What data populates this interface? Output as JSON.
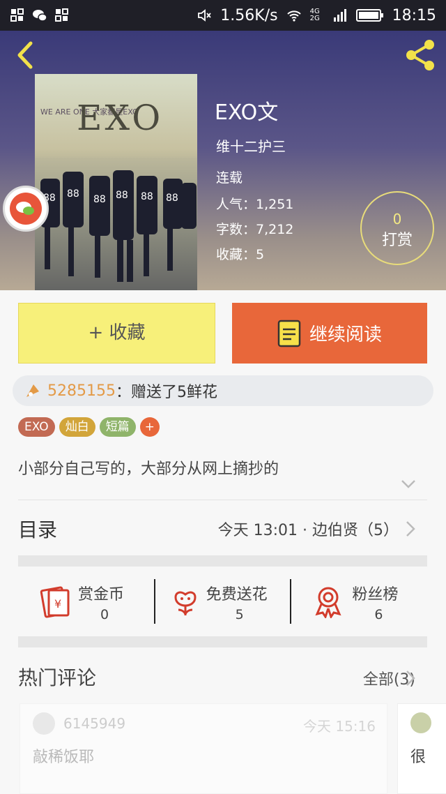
{
  "status_bar": {
    "speed": "1.56K/s",
    "network": "4G 2G",
    "time": "18:15"
  },
  "book": {
    "title": "EXO文",
    "author": "维十二护三",
    "state": "连载",
    "popularity": "人气：1,251",
    "word_count": "字数：7,212",
    "favorites": "收藏：5",
    "tip_count": "0",
    "tip_label": "打赏",
    "cover_logo": "EXO",
    "cover_tag": "WE ARE ONE 大家都是EXO"
  },
  "actions": {
    "favorite": "+ 收藏",
    "continue_read": "继续阅读"
  },
  "gift_notice": {
    "user": "5285155",
    "text": "：赠送了5鲜花"
  },
  "tags": [
    {
      "label": "EXO",
      "color": "#c26a53"
    },
    {
      "label": "灿白",
      "color": "#d2a53a"
    },
    {
      "label": "短篇",
      "color": "#8fb46a"
    },
    {
      "label": "+",
      "color": "#e8673a"
    }
  ],
  "description": "小部分自己写的，大部分从网上摘抄的",
  "toc": {
    "label": "目录",
    "latest": "今天 13:01 · 边伯贤（5）"
  },
  "stats": [
    {
      "label": "赏金币",
      "value": "0"
    },
    {
      "label": "免费送花",
      "value": "5"
    },
    {
      "label": "粉丝榜",
      "value": "6"
    }
  ],
  "comments": {
    "heading": "热门评论",
    "all_label": "全部(3)",
    "items": [
      {
        "user": "6145949",
        "time": "今天 15:16",
        "text": "敲稀饭耶"
      },
      {
        "text": "很"
      }
    ]
  },
  "colors": {
    "accent_orange": "#e8673a",
    "accent_yellow": "#f7f07a",
    "gift_user": "#e39a47"
  }
}
